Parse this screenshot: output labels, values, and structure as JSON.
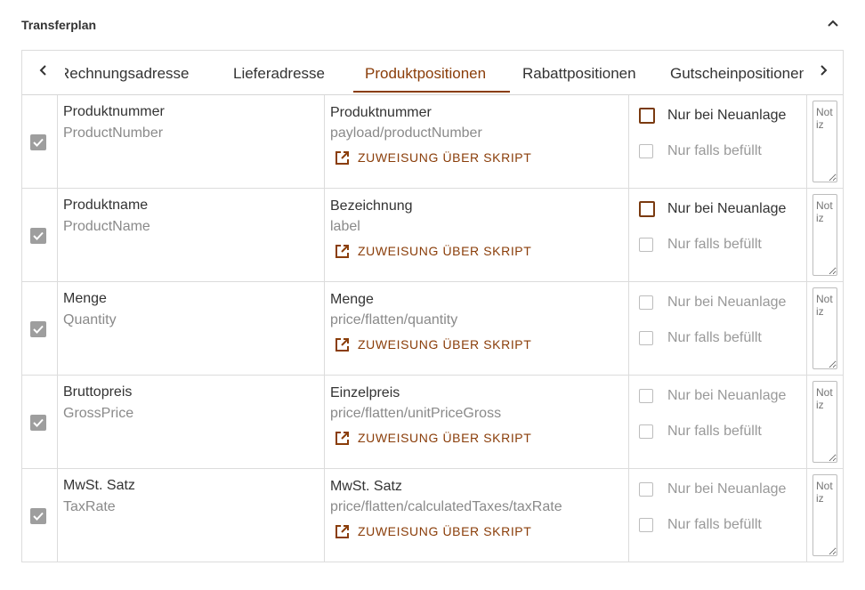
{
  "panel": {
    "title": "Transferplan"
  },
  "tabs": [
    {
      "label": "Rechnungsadresse",
      "active": false
    },
    {
      "label": "Lieferadresse",
      "active": false
    },
    {
      "label": "Produktpositionen",
      "active": true
    },
    {
      "label": "Rabattpositionen",
      "active": false
    },
    {
      "label": "Gutscheinpositionen",
      "active": false
    }
  ],
  "colors": {
    "accent": "#8a3d09",
    "checkbox_disabled": "#9e9e9e",
    "border": "#dcdcdc"
  },
  "icons": {
    "collapse": "chevron-up-icon",
    "tab_prev": "chevron-left-icon",
    "tab_next": "chevron-right-icon",
    "script": "open-in-new-icon"
  },
  "rows": [
    {
      "checked": true,
      "source_label": "Produktnummer",
      "source_key": "ProductNumber",
      "target_label": "Produktnummer",
      "target_path": "payload/productNumber",
      "script_link": "ZUWEISUNG ÜBER SKRIPT",
      "option_new_only": "Nur bei Neuanlage",
      "option_new_only_enabled": true,
      "option_if_filled": "Nur falls befüllt",
      "notes_placeholder": "Notiz"
    },
    {
      "checked": true,
      "source_label": "Produktname",
      "source_key": "ProductName",
      "target_label": "Bezeichnung",
      "target_path": "label",
      "script_link": "ZUWEISUNG ÜBER SKRIPT",
      "option_new_only": "Nur bei Neuanlage",
      "option_new_only_enabled": true,
      "option_if_filled": "Nur falls befüllt",
      "notes_placeholder": "Notiz"
    },
    {
      "checked": true,
      "source_label": "Menge",
      "source_key": "Quantity",
      "target_label": "Menge",
      "target_path": "price/flatten/quantity",
      "script_link": "ZUWEISUNG ÜBER SKRIPT",
      "option_new_only": "Nur bei Neuanlage",
      "option_new_only_enabled": false,
      "option_if_filled": "Nur falls befüllt",
      "notes_placeholder": "Notiz"
    },
    {
      "checked": true,
      "source_label": "Bruttopreis",
      "source_key": "GrossPrice",
      "target_label": "Einzelpreis",
      "target_path": "price/flatten/unitPriceGross",
      "script_link": "ZUWEISUNG ÜBER SKRIPT",
      "option_new_only": "Nur bei Neuanlage",
      "option_new_only_enabled": false,
      "option_if_filled": "Nur falls befüllt",
      "notes_placeholder": "Notiz"
    },
    {
      "checked": true,
      "source_label": "MwSt. Satz",
      "source_key": "TaxRate",
      "target_label": "MwSt. Satz",
      "target_path": "price/flatten/calculatedTaxes/taxRate",
      "script_link": "ZUWEISUNG ÜBER SKRIPT",
      "option_new_only": "Nur bei Neuanlage",
      "option_new_only_enabled": false,
      "option_if_filled": "Nur falls befüllt",
      "notes_placeholder": "Notiz"
    }
  ]
}
